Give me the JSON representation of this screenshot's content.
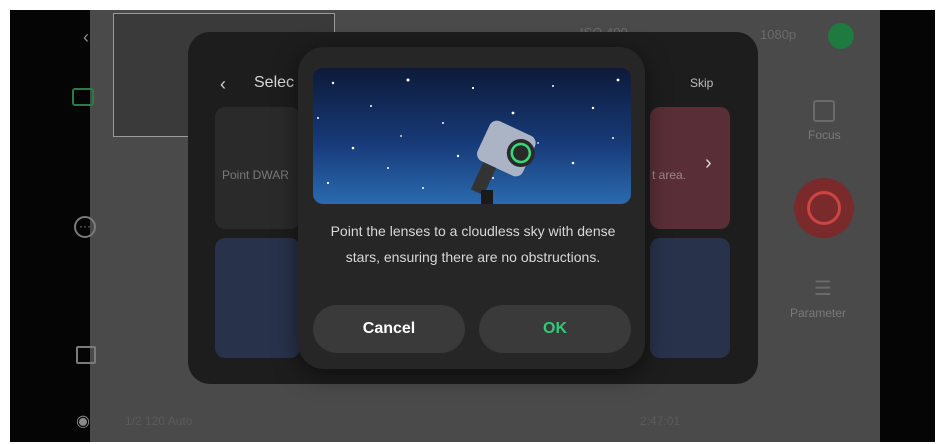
{
  "top": {
    "status_text": "ISO 400",
    "resolution": "1080p"
  },
  "panel": {
    "back_icon": "chevron-left",
    "title": "Selec",
    "skip_label": "Skip",
    "card_left_text": "Point DWAR",
    "card_right_text": "t area.",
    "chevron": "chevron-right"
  },
  "right_controls": {
    "focus_label": "Focus",
    "parameter_label": "Parameter"
  },
  "bottom": {
    "left_text": "1/2 120 Auto",
    "right_text": "2:47:01"
  },
  "dialog": {
    "message": "Point the lenses to a cloudless sky with dense stars, ensuring there are no obstructions.",
    "cancel_label": "Cancel",
    "ok_label": "OK"
  },
  "colors": {
    "ok_green": "#2fc97a",
    "dialog_bg": "#262626",
    "button_bg": "#3a3a3a",
    "record_green": "#1e7a3e"
  }
}
